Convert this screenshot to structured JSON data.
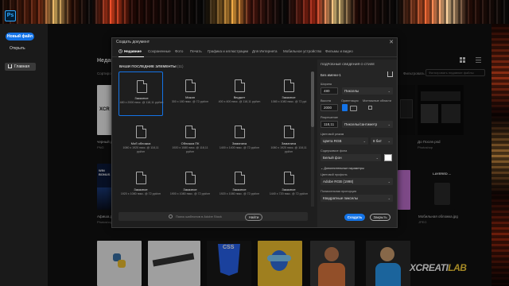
{
  "app": {
    "logo": "Ps"
  },
  "sidebar": {
    "new_file": "Новый файл",
    "open": "Открыть",
    "home": "Главная"
  },
  "home": {
    "title": "Недав",
    "sort": "Сортиро",
    "filter_label": "Фильтровать",
    "filter_placeholder": "Фильтровать недавние файлы",
    "thumbs": [
      {
        "label": "черный д",
        "sub": "PNG"
      },
      {
        "label": "До После.psd",
        "sub": "Photoshop"
      },
      {
        "label": "Афиша.p",
        "sub": "Photoshop"
      },
      {
        "label": "Мобильная обложка.jpg",
        "sub": "JPEG"
      }
    ],
    "thumb_texts": {
      "xcr": "XCR",
      "win_bonus": "WIN BONUS",
      "win_full": "WIN BONUS COMP",
      "layered": "LAYERED ..."
    }
  },
  "brand": {
    "main": "XCREATI",
    "accent": "LAB"
  },
  "dialog": {
    "title": "Создать документ",
    "close": "✕",
    "tabs": [
      "Недавние",
      "Сохраненные",
      "Фото",
      "Печать",
      "Графика и иллюстрации",
      "Для Интернета",
      "Мобильное устройство",
      "Фильмы и видео"
    ],
    "recent_header": "ВАШИ ПОСЛЕДНИЕ ЭЛЕМЕНТЫ",
    "recent_count": "(11)",
    "presets": [
      {
        "name": "Заказное",
        "size": "480 x 2000 пикс. @ 118,11 ppi/cm",
        "selected": true
      },
      {
        "name": "Мокап",
        "size": "300 x 180 пикс. @ 72 ppi/cm",
        "selected": false
      },
      {
        "name": "Вюджет",
        "size": "400 x 400 пикс. @ 118,11 ppi/cm",
        "selected": false
      },
      {
        "name": "Заказное",
        "size": "1080 x 1080 пикс. @ 72 ppi",
        "selected": false
      },
      {
        "name": "Моб обложка",
        "size": "1080 x 1920 пикс. @ 118,11 ppi/cm",
        "selected": false
      },
      {
        "name": "Обложка ПК",
        "size": "1920 x 1080 пикс. @ 118,11 ppi/cm",
        "selected": false
      },
      {
        "name": "Заманиха",
        "size": "1400 x 1400 пикс. @ 72 ppi/cm",
        "selected": false
      },
      {
        "name": "Заманиха",
        "size": "1080 x 1920 пикс. @ 118,11 ppi/cm",
        "selected": false
      },
      {
        "name": "Заказное",
        "size": "1920 x 1080 пикс. @ 72 ppi/cm",
        "selected": false
      },
      {
        "name": "Заказное",
        "size": "1900 x 1080 пикс. @ 72 ppi/cm",
        "selected": false
      },
      {
        "name": "Заказное",
        "size": "1920 x 1080 пикс. @ 72 ppi/cm",
        "selected": false
      },
      {
        "name": "Заказное",
        "size": "1440 x 720 пикс. @ 72 ppi/cm",
        "selected": false
      }
    ],
    "search_placeholder": "Поиск шаблонов в Adobe Stock",
    "find_button": "Найти",
    "details": {
      "title": "ПОДРОБНЫЕ СВЕДЕНИЯ О СТИЛЕ",
      "name": "Без имени-1",
      "width_label": "Ширина",
      "width_value": "480",
      "width_unit": "Пикселы",
      "height_label": "Высота",
      "height_value": "2000",
      "orientation_label": "Ориентация",
      "artboards_label": "Монтажные области",
      "resolution_label": "Разрешение",
      "resolution_value": "118,11",
      "resolution_unit": "Пикселы/сантиметр",
      "color_mode_label": "Цветовой режим",
      "color_mode": "Цвета RGB",
      "bit_depth": "8 бит",
      "background_label": "Содержимое фона",
      "background_value": "Белый фон",
      "advanced_label": "Дополнительные параметры",
      "profile_label": "Цветовой профиль",
      "profile_value": "Adobe RGB (1998)",
      "pixel_ratio_label": "Попиксельная пропорция",
      "pixel_ratio_value": "Квадратные пикселы"
    },
    "create_button": "Создать",
    "close_button": "Закрыть"
  }
}
